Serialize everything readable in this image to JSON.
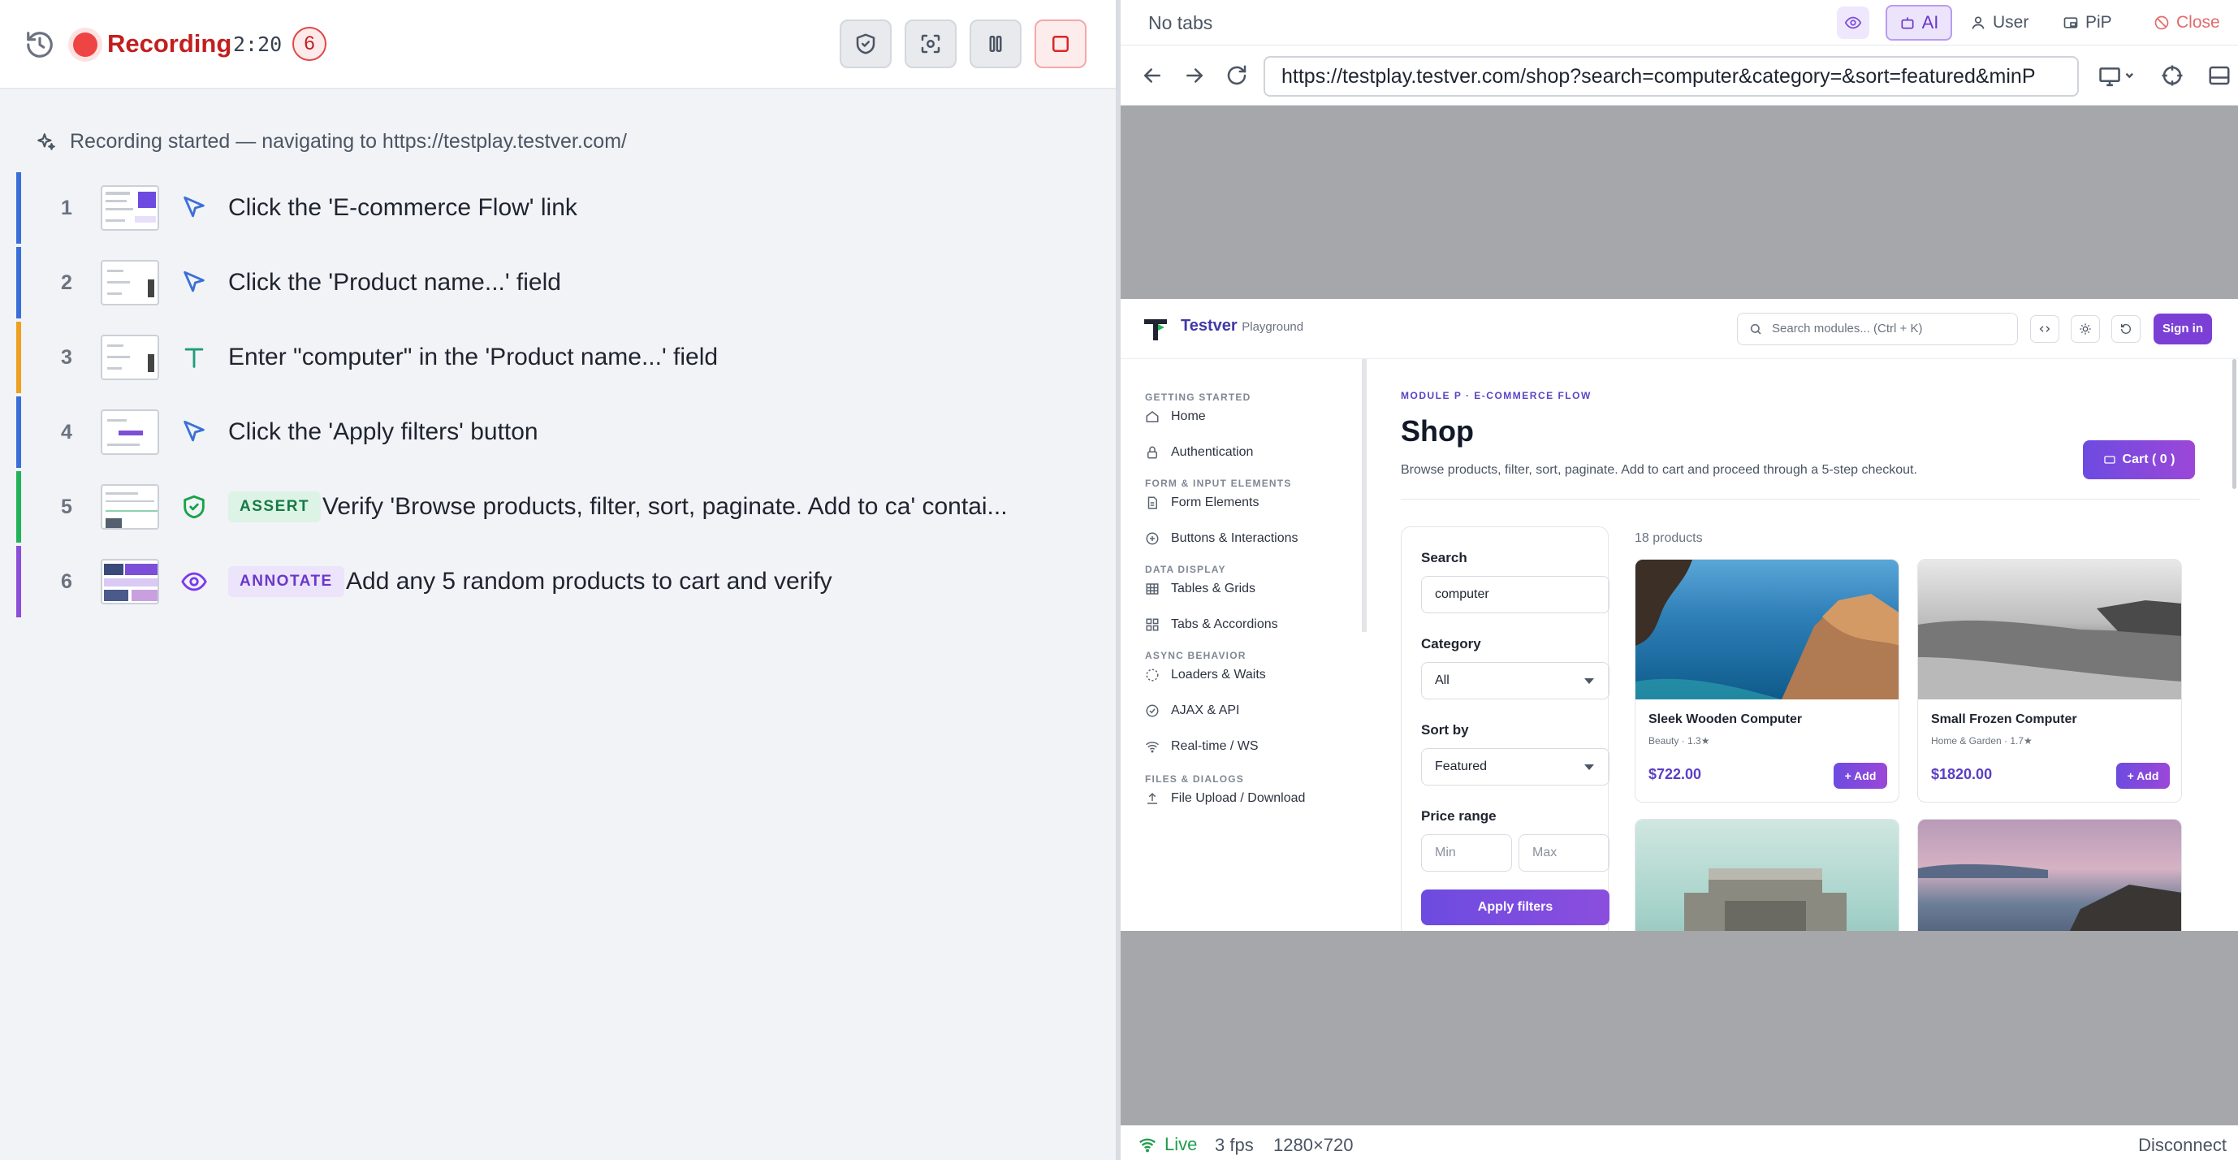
{
  "recorder": {
    "status_label": "Recording",
    "elapsed": "2:20",
    "step_count": "6",
    "started_message": "Recording started — navigating to https://testplay.testver.com/",
    "steps": [
      {
        "num": "1",
        "kind": "click",
        "text": "Click the 'E-commerce Flow' link",
        "icon": "cursor-icon"
      },
      {
        "num": "2",
        "kind": "click",
        "text": "Click the 'Product name...' field",
        "icon": "cursor-icon"
      },
      {
        "num": "3",
        "kind": "type",
        "text": "Enter \"computer\" in the 'Product name...' field",
        "icon": "text-icon"
      },
      {
        "num": "4",
        "kind": "click",
        "text": "Click the 'Apply filters' button",
        "icon": "cursor-icon"
      },
      {
        "num": "5",
        "kind": "assert",
        "badge": "ASSERT",
        "text": "Verify 'Browse products, filter, sort, paginate. Add to ca' contai...",
        "icon": "shield-check-icon"
      },
      {
        "num": "6",
        "kind": "annotate",
        "badge": "ANNOTATE",
        "text": "Add any 5 random products to cart and verify",
        "icon": "eye-icon"
      }
    ],
    "colors": {
      "click": "#3b6fd8",
      "type": "#f0a020",
      "assert": "#22b35a",
      "annotate": "#8b4fd8",
      "recording": "#ef4444"
    }
  },
  "browser": {
    "no_tabs": "No tabs",
    "ai_label": "AI",
    "user_label": "User",
    "pip_label": "PiP",
    "close_label": "Close",
    "url": "https://testplay.testver.com/shop?search=computer&category=&sort=featured&minP",
    "status": {
      "live": "Live",
      "fps": "3 fps",
      "resolution": "1280×720",
      "disconnect": "Disconnect"
    }
  },
  "page": {
    "brand": "Testver",
    "brand_sub": "Playground",
    "search_placeholder": "Search modules... (Ctrl + K)",
    "signin": "Sign in",
    "sidebar": {
      "getting_started": "GETTING STARTED",
      "home": "Home",
      "authentication": "Authentication",
      "form_input": "FORM & INPUT ELEMENTS",
      "form_elements": "Form Elements",
      "buttons_interactions": "Buttons & Interactions",
      "data_display": "DATA DISPLAY",
      "tables_grids": "Tables & Grids",
      "tabs_accordions": "Tabs & Accordions",
      "async_behavior": "ASYNC BEHAVIOR",
      "loaders_waits": "Loaders & Waits",
      "ajax_api": "AJAX & API",
      "realtime_ws": "Real-time / WS",
      "files_dialogs": "FILES & DIALOGS",
      "file_upload": "File Upload / Download"
    },
    "module": "MODULE P · E-COMMERCE FLOW",
    "title": "Shop",
    "description": "Browse products, filter, sort, paginate. Add to cart and proceed through a 5-step checkout.",
    "cart_label": "Cart ( 0 )",
    "filters": {
      "search_label": "Search",
      "search_value": "computer",
      "category_label": "Category",
      "category_value": "All",
      "sort_label": "Sort by",
      "sort_value": "Featured",
      "price_label": "Price range",
      "min_placeholder": "Min",
      "max_placeholder": "Max",
      "apply": "Apply filters"
    },
    "product_count": "18 products",
    "products": [
      {
        "name": "Sleek Wooden Computer",
        "meta": "Beauty · 1.3★",
        "price": "$722.00",
        "add": "+ Add"
      },
      {
        "name": "Small Frozen Computer",
        "meta": "Home & Garden · 1.7★",
        "price": "$1820.00",
        "add": "+ Add"
      }
    ]
  }
}
